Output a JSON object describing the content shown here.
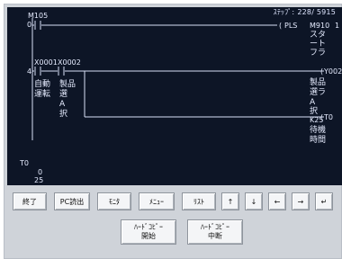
{
  "status_bar": {
    "label": "ｽﾃｯﾌﾟ:",
    "value": "228/ 5915"
  },
  "ladder": {
    "step_numbers": [
      "0",
      "4"
    ],
    "contacts": [
      {
        "device": "M105"
      },
      {
        "device": "X0001",
        "comment_lines": [
          "自動",
          "運転"
        ]
      },
      {
        "device": "X0002",
        "comment_lines": [
          "製品",
          "選",
          "A",
          "択"
        ]
      }
    ],
    "instruction": {
      "mnemonic": "PLS",
      "device": "M910",
      "comment_lines": [
        "1",
        "スタ",
        "ート",
        "フラ"
      ]
    },
    "coils": [
      {
        "device": "Y0023",
        "comment_lines": [
          "製品",
          "選ラ",
          "A",
          "択",
          "K25"
        ]
      },
      {
        "device": "T0",
        "comment_lines": [
          "待機",
          "時間"
        ]
      }
    ]
  },
  "monitor": {
    "device": "T0",
    "value": "0",
    "setting": "25"
  },
  "buttons": {
    "row1": [
      "終了",
      "PC読出",
      "ﾓﾆﾀ",
      "ﾒﾆｭｰ",
      "ﾘｽﾄ",
      "↑",
      "↓",
      "←",
      "→",
      "↵"
    ],
    "hardcopy_start": [
      "ﾊｰﾄﾞｺﾋﾟｰ",
      "開始"
    ],
    "hardcopy_stop": [
      "ﾊｰﾄﾞｺﾋﾟｰ",
      "中断"
    ]
  }
}
